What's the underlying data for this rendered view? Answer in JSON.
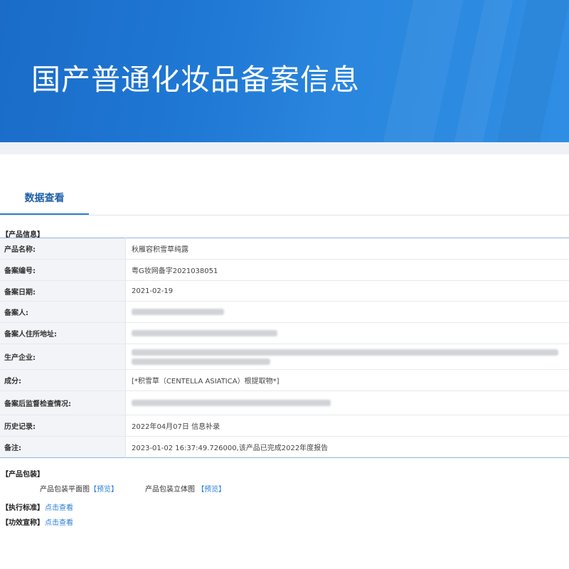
{
  "banner": {
    "title": "国产普通化妆品备案信息"
  },
  "tabs": [
    {
      "label": "数据查看"
    }
  ],
  "product_info": {
    "section_title": "【产品信息】",
    "rows": [
      {
        "label": "产品名称:",
        "value": "秋雁容积雪草纯露"
      },
      {
        "label": "备案编号:",
        "value": "粤G妆网备字2021038051"
      },
      {
        "label": "备案日期:",
        "value": "2021-02-19"
      },
      {
        "label": "备案人:",
        "value": ""
      },
      {
        "label": "备案人住所地址:",
        "value": ""
      },
      {
        "label": "生产企业:",
        "value": ""
      },
      {
        "label": "成分:",
        "value": "[*积雪草（CENTELLA ASIATICA）根提取物*]"
      },
      {
        "label": "备案后监督检查情况:",
        "value": ""
      },
      {
        "label": "历史记录:",
        "value": "2022年04月07日 信息补录"
      },
      {
        "label": "备注:",
        "value": "2023-01-02 16:37:49.726000,该产品已完成2022年度报告"
      }
    ]
  },
  "packaging": {
    "section_title": "【产品包装】",
    "flat_label": "产品包装平面图",
    "flat_link": "【预览】",
    "three_d_label": "产品包装立体图",
    "three_d_link": "【预览】"
  },
  "standard": {
    "section_title": "【执行标准】",
    "link": "点击查看"
  },
  "efficacy": {
    "section_title": "【功效宣称】",
    "link": "点击查看"
  }
}
